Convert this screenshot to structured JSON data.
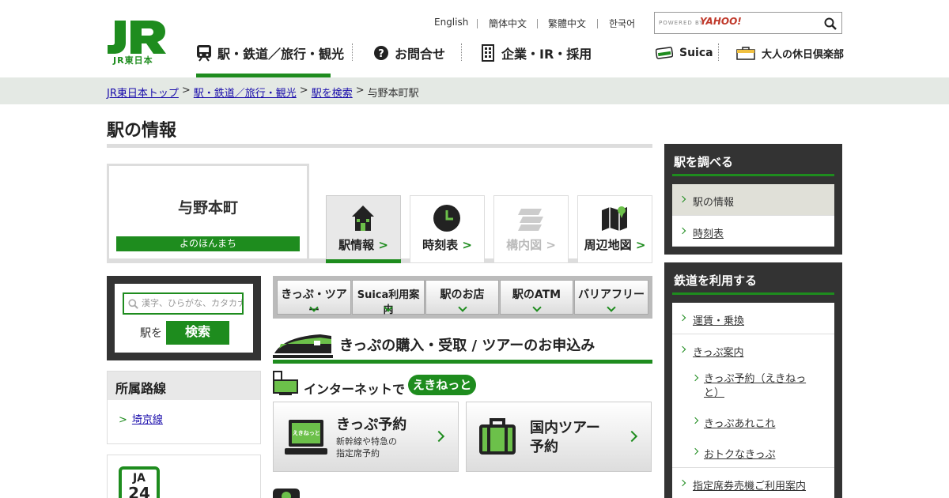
{
  "header": {
    "logo_text": "JR東日本",
    "languages": [
      "English",
      "簡体中文",
      "繁體中文",
      "한국어"
    ],
    "search_powered": "POWERED BY",
    "search_brand": "YAHOO!",
    "nav": [
      "駅・鉄道／旅行・観光",
      "お問合せ",
      "企業・IR・採用"
    ],
    "nav_right": [
      "Suica",
      "大人の休日倶楽部"
    ]
  },
  "breadcrumb": [
    "JR東日本トップ",
    "駅・鉄道／旅行・観光",
    "駅を検索",
    "与野本町駅"
  ],
  "page_title": "駅の情報",
  "station": {
    "name": "与野本町",
    "kana": "よのほんまち"
  },
  "station_tabs": [
    "駅情報",
    "時刻表",
    "構内図",
    "周辺地図"
  ],
  "search": {
    "placeholder": "漢字、ひらがな、カタカナ",
    "label": "駅を",
    "button": "検索"
  },
  "lines": {
    "heading": "所属路線",
    "items": [
      "埼京線"
    ]
  },
  "station_code": {
    "line": "JA",
    "number": "24"
  },
  "category_tabs": [
    "きっぷ・ツアー",
    "Suica利用案内",
    "駅のお店",
    "駅のATM",
    "バリアフリー"
  ],
  "section": {
    "title": "きっぷの購入・受取 / ツアーのお申込み",
    "net_label": "インターネットで",
    "ekinet": "えきねっと",
    "buttons": [
      {
        "title": "きっぷ予約",
        "sub1": "新幹線や特急の",
        "sub2": "指定席予約",
        "icon_label": "えきねっと"
      },
      {
        "title1": "国内ツアー",
        "title2": "予約"
      }
    ]
  },
  "sidebar": {
    "panel1": {
      "heading": "駅を調べる",
      "items": [
        "駅の情報",
        "時刻表"
      ]
    },
    "panel2": {
      "heading": "鉄道を利用する",
      "items": [
        "運賃・乗換",
        "きっぷ案内"
      ],
      "subitems": [
        "きっぷ予約（えきねっと）",
        "きっぷあれこれ",
        "おトクなきっぷ"
      ],
      "more": "指定席券売機ご利用案内"
    }
  },
  "colors": {
    "brand_green": "#1e8c1e",
    "dark_panel": "#333333",
    "crumb_bg": "#e4e9e4"
  }
}
